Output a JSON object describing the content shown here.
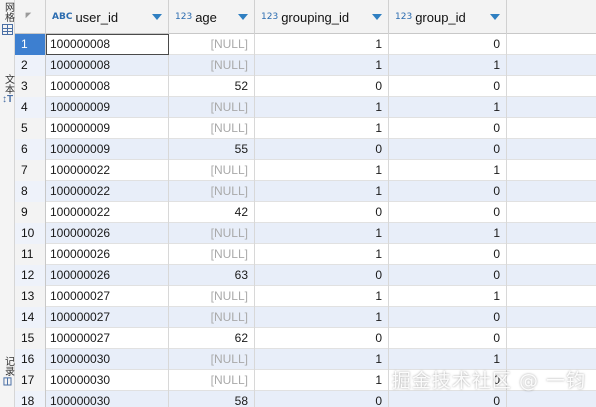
{
  "side_tabs": {
    "grid_label": "网格",
    "text_label": "文本",
    "record_label": "记录"
  },
  "columns": [
    {
      "type_tag": "ABC",
      "label": "user_id"
    },
    {
      "type_tag": "123",
      "label": "age"
    },
    {
      "type_tag": "123",
      "label": "grouping_id"
    },
    {
      "type_tag": "123",
      "label": "group_id"
    }
  ],
  "rows": [
    {
      "n": "1",
      "user_id": "100000008",
      "age": "[NULL]",
      "grouping_id": "1",
      "group_id": "0"
    },
    {
      "n": "2",
      "user_id": "100000008",
      "age": "[NULL]",
      "grouping_id": "1",
      "group_id": "1"
    },
    {
      "n": "3",
      "user_id": "100000008",
      "age": "52",
      "grouping_id": "0",
      "group_id": "0"
    },
    {
      "n": "4",
      "user_id": "100000009",
      "age": "[NULL]",
      "grouping_id": "1",
      "group_id": "1"
    },
    {
      "n": "5",
      "user_id": "100000009",
      "age": "[NULL]",
      "grouping_id": "1",
      "group_id": "0"
    },
    {
      "n": "6",
      "user_id": "100000009",
      "age": "55",
      "grouping_id": "0",
      "group_id": "0"
    },
    {
      "n": "7",
      "user_id": "100000022",
      "age": "[NULL]",
      "grouping_id": "1",
      "group_id": "1"
    },
    {
      "n": "8",
      "user_id": "100000022",
      "age": "[NULL]",
      "grouping_id": "1",
      "group_id": "0"
    },
    {
      "n": "9",
      "user_id": "100000022",
      "age": "42",
      "grouping_id": "0",
      "group_id": "0"
    },
    {
      "n": "10",
      "user_id": "100000026",
      "age": "[NULL]",
      "grouping_id": "1",
      "group_id": "1"
    },
    {
      "n": "11",
      "user_id": "100000026",
      "age": "[NULL]",
      "grouping_id": "1",
      "group_id": "0"
    },
    {
      "n": "12",
      "user_id": "100000026",
      "age": "63",
      "grouping_id": "0",
      "group_id": "0"
    },
    {
      "n": "13",
      "user_id": "100000027",
      "age": "[NULL]",
      "grouping_id": "1",
      "group_id": "1"
    },
    {
      "n": "14",
      "user_id": "100000027",
      "age": "[NULL]",
      "grouping_id": "1",
      "group_id": "0"
    },
    {
      "n": "15",
      "user_id": "100000027",
      "age": "62",
      "grouping_id": "0",
      "group_id": "0"
    },
    {
      "n": "16",
      "user_id": "100000030",
      "age": "[NULL]",
      "grouping_id": "1",
      "group_id": "1"
    },
    {
      "n": "17",
      "user_id": "100000030",
      "age": "[NULL]",
      "grouping_id": "1",
      "group_id": "0"
    },
    {
      "n": "18",
      "user_id": "100000030",
      "age": "58",
      "grouping_id": "0",
      "group_id": "0"
    }
  ],
  "selected_row": 1,
  "watermark": "掘金技术社区 @ 一钧",
  "colors": {
    "accent": "#2f7fc1",
    "alt_row": "#e8eef9",
    "selected_row_number": "#3d7fd0",
    "null_text": "#a9a9a9"
  }
}
